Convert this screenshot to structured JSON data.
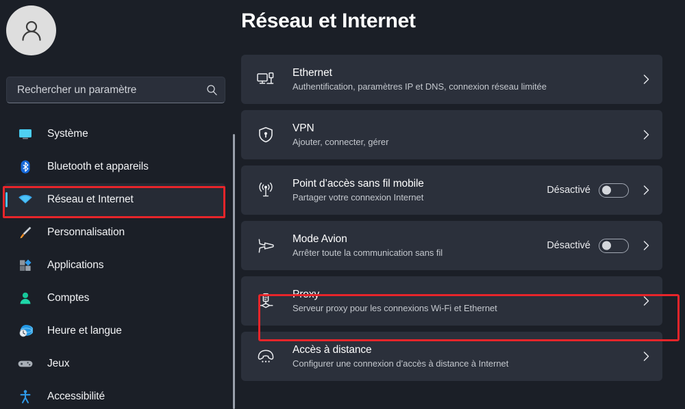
{
  "sidebar": {
    "avatar_icon": "user-avatar-icon",
    "search": {
      "placeholder": "Rechercher un paramètre",
      "value": "",
      "icon": "search-icon"
    },
    "items": [
      {
        "label": "Système",
        "icon": "monitor-icon",
        "selected": false
      },
      {
        "label": "Bluetooth et appareils",
        "icon": "bluetooth-icon",
        "selected": false
      },
      {
        "label": "Réseau et Internet",
        "icon": "wifi-icon",
        "selected": true
      },
      {
        "label": "Personnalisation",
        "icon": "paintbrush-icon",
        "selected": false
      },
      {
        "label": "Applications",
        "icon": "apps-icon",
        "selected": false
      },
      {
        "label": "Comptes",
        "icon": "person-icon",
        "selected": false
      },
      {
        "label": "Heure et langue",
        "icon": "clock-globe-icon",
        "selected": false
      },
      {
        "label": "Jeux",
        "icon": "gamepad-icon",
        "selected": false
      },
      {
        "label": "Accessibilité",
        "icon": "accessibility-icon",
        "selected": false
      }
    ]
  },
  "main": {
    "title": "Réseau et Internet",
    "cards": [
      {
        "title": "Ethernet",
        "subtitle": "Authentification, paramètres IP et DNS, connexion réseau limitée",
        "icon": "ethernet-icon",
        "toggle": null,
        "chevron": "chevron-right-icon"
      },
      {
        "title": "VPN",
        "subtitle": "Ajouter, connecter, gérer",
        "icon": "vpn-shield-icon",
        "toggle": null,
        "chevron": "chevron-right-icon"
      },
      {
        "title": "Point d’accès sans fil mobile",
        "subtitle": "Partager votre connexion Internet",
        "icon": "hotspot-icon",
        "toggle": {
          "label": "Désactivé",
          "state": "off"
        },
        "chevron": "chevron-right-icon"
      },
      {
        "title": "Mode Avion",
        "subtitle": "Arrêter toute la communication sans fil",
        "icon": "airplane-icon",
        "toggle": {
          "label": "Désactivé",
          "state": "off"
        },
        "chevron": "chevron-right-icon"
      },
      {
        "title": "Proxy",
        "subtitle": "Serveur proxy pour les connexions Wi-Fi et Ethernet",
        "icon": "proxy-server-icon",
        "toggle": null,
        "chevron": "chevron-right-icon"
      },
      {
        "title": "Accès à distance",
        "subtitle": "Configurer une connexion d’accès à distance à Internet",
        "icon": "dialup-phone-icon",
        "toggle": null,
        "chevron": "chevron-right-icon"
      }
    ]
  },
  "annotations": {
    "highlight_color": "#e8252a",
    "highlighted_sidebar_item": "Réseau et Internet",
    "highlighted_card": "Proxy"
  },
  "colors": {
    "page_background": "#1b1f27",
    "card_background": "#2b303b",
    "accent": "#4cc2ff",
    "selected_nav_background": "#262b35"
  }
}
